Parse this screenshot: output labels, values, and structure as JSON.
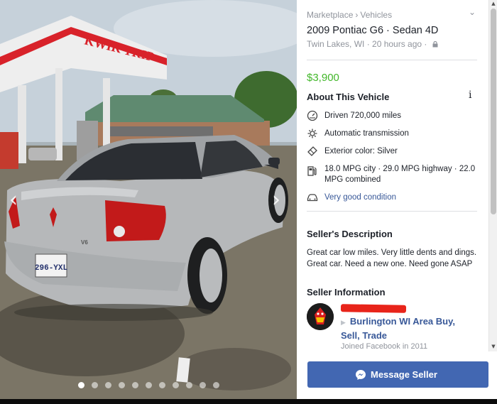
{
  "breadcrumb": {
    "items": [
      "Marketplace",
      "Vehicles"
    ],
    "separator": "›"
  },
  "listing": {
    "title": "2009 Pontiac G6 · Sedan 4D",
    "location_time": "Twin Lakes, WI · 20 hours ago ·",
    "price": "$3,900"
  },
  "about": {
    "heading": "About This Vehicle",
    "info_glyph": "i",
    "rows": [
      {
        "icon": "speedometer-icon",
        "text": "Driven 720,000 miles"
      },
      {
        "icon": "transmission-icon",
        "text": "Automatic transmission"
      },
      {
        "icon": "paint-icon",
        "text": "Exterior color: Silver"
      },
      {
        "icon": "fuel-pump-icon",
        "text": "18.0 MPG city · 29.0 MPG highway · 22.0 MPG combined"
      },
      {
        "icon": "car-icon",
        "text": "Very good condition"
      }
    ]
  },
  "description": {
    "heading": "Seller's Description",
    "text": "Great car low miles. Very little dents and dings. Great car. Need a new one. Need gone ASAP"
  },
  "seller": {
    "heading": "Seller Information",
    "group_link": "Burlington WI Area Buy, Sell, Trade",
    "joined": "Joined Facebook in 2011"
  },
  "actions": {
    "message_label": "Message Seller"
  },
  "photo": {
    "sign_text": "KWIK TRIP",
    "plate_text": "296-YXL",
    "badge_text": "V6",
    "dot_count": 11,
    "active_dot": 0
  },
  "colors": {
    "accent": "#4267b2",
    "link": "#385898",
    "price": "#42b72a",
    "muted": "#90949c",
    "redaction": "#e8241a"
  }
}
